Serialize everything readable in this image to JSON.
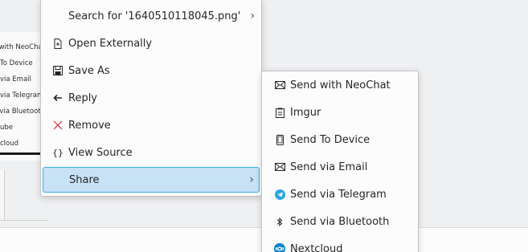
{
  "background": {
    "share_items": [
      "with NeoChat",
      "To Device",
      "via Email",
      "via Telegram",
      "via Bluetooth",
      "ube",
      "cloud"
    ]
  },
  "context_menu": {
    "items": [
      {
        "label": "Search for '1640510118045.png'",
        "icon": "",
        "submenu": true
      },
      {
        "label": "Open Externally",
        "icon": "document-open-icon"
      },
      {
        "label": "Save As",
        "icon": "save-icon"
      },
      {
        "label": "Reply",
        "icon": "reply-arrow-icon"
      },
      {
        "label": "Remove",
        "icon": "remove-x-icon"
      },
      {
        "label": "View Source",
        "icon": "code-braces-icon"
      },
      {
        "label": "Share",
        "icon": "",
        "submenu": true,
        "highlighted": true
      }
    ]
  },
  "share_menu": {
    "items": [
      {
        "label": "Send with NeoChat",
        "icon": "envelope-icon"
      },
      {
        "label": "Imgur",
        "icon": "clipboard-icon"
      },
      {
        "label": "Send To Device",
        "icon": "phone-icon"
      },
      {
        "label": "Send via Email",
        "icon": "envelope-icon"
      },
      {
        "label": "Send via Telegram",
        "icon": "telegram-icon"
      },
      {
        "label": "Send via Bluetooth",
        "icon": "bluetooth-icon"
      },
      {
        "label": "Nextcloud",
        "icon": "nextcloud-icon"
      }
    ]
  },
  "colors": {
    "highlight_bg": "#c7e1f5",
    "highlight_border": "#3daee9",
    "telegram": "#2ca5e0",
    "nextcloud": "#0082c9",
    "remove": "#da4453"
  }
}
